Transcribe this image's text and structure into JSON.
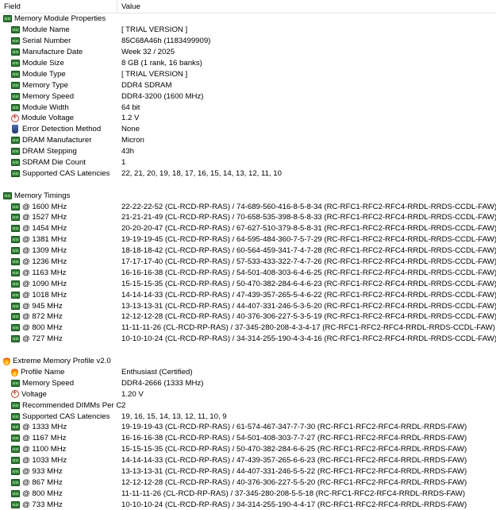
{
  "header": {
    "field": "Field",
    "value": "Value"
  },
  "rows": [
    {
      "type": "section",
      "icon": "ram",
      "field": "Memory Module Properties",
      "value": ""
    },
    {
      "type": "item",
      "icon": "ram",
      "field": "Module Name",
      "value": "[ TRIAL VERSION ]"
    },
    {
      "type": "item",
      "icon": "ram",
      "field": "Serial Number",
      "value": "85C68A46h (1183499909)"
    },
    {
      "type": "item",
      "icon": "ram",
      "field": "Manufacture Date",
      "value": "Week 32 / 2025"
    },
    {
      "type": "item",
      "icon": "ram",
      "field": "Module Size",
      "value": "8 GB (1 rank, 16 banks)"
    },
    {
      "type": "item",
      "icon": "ram",
      "field": "Module Type",
      "value": "[ TRIAL VERSION ]"
    },
    {
      "type": "item",
      "icon": "ram",
      "field": "Memory Type",
      "value": "DDR4 SDRAM"
    },
    {
      "type": "item",
      "icon": "ram",
      "field": "Memory Speed",
      "value": "DDR4-3200 (1600 MHz)"
    },
    {
      "type": "item",
      "icon": "ram",
      "field": "Module Width",
      "value": "64 bit"
    },
    {
      "type": "item",
      "icon": "volt",
      "field": "Module Voltage",
      "value": "1.2 V"
    },
    {
      "type": "item",
      "icon": "shield",
      "field": "Error Detection Method",
      "value": "None"
    },
    {
      "type": "item",
      "icon": "ram",
      "field": "DRAM Manufacturer",
      "value": "Micron"
    },
    {
      "type": "item",
      "icon": "ram",
      "field": "DRAM Stepping",
      "value": "43h"
    },
    {
      "type": "item",
      "icon": "ram",
      "field": "SDRAM Die Count",
      "value": "1"
    },
    {
      "type": "item",
      "icon": "ram",
      "field": "Supported CAS Latencies",
      "value": "22, 21, 20, 19, 18, 17, 16, 15, 14, 13, 12, 11, 10"
    },
    {
      "type": "blank"
    },
    {
      "type": "section",
      "icon": "ram",
      "field": "Memory Timings",
      "value": ""
    },
    {
      "type": "item",
      "icon": "ram",
      "field": "@ 1600 MHz",
      "value": "22-22-22-52  (CL-RCD-RP-RAS) / 74-689-560-416-8-5-8-34  (RC-RFC1-RFC2-RFC4-RRDL-RRDS-CCDL-FAW)"
    },
    {
      "type": "item",
      "icon": "ram",
      "field": "@ 1527 MHz",
      "value": "21-21-21-49  (CL-RCD-RP-RAS) / 70-658-535-398-8-5-8-33  (RC-RFC1-RFC2-RFC4-RRDL-RRDS-CCDL-FAW)"
    },
    {
      "type": "item",
      "icon": "ram",
      "field": "@ 1454 MHz",
      "value": "20-20-20-47  (CL-RCD-RP-RAS) / 67-627-510-379-8-5-8-31  (RC-RFC1-RFC2-RFC4-RRDL-RRDS-CCDL-FAW)"
    },
    {
      "type": "item",
      "icon": "ram",
      "field": "@ 1381 MHz",
      "value": "19-19-19-45  (CL-RCD-RP-RAS) / 64-595-484-360-7-5-7-29  (RC-RFC1-RFC2-RFC4-RRDL-RRDS-CCDL-FAW)"
    },
    {
      "type": "item",
      "icon": "ram",
      "field": "@ 1309 MHz",
      "value": "18-18-18-42  (CL-RCD-RP-RAS) / 60-564-459-341-7-4-7-28  (RC-RFC1-RFC2-RFC4-RRDL-RRDS-CCDL-FAW)"
    },
    {
      "type": "item",
      "icon": "ram",
      "field": "@ 1236 MHz",
      "value": "17-17-17-40  (CL-RCD-RP-RAS) / 57-533-433-322-7-4-7-26  (RC-RFC1-RFC2-RFC4-RRDL-RRDS-CCDL-FAW)"
    },
    {
      "type": "item",
      "icon": "ram",
      "field": "@ 1163 MHz",
      "value": "16-16-16-38  (CL-RCD-RP-RAS) / 54-501-408-303-6-4-6-25  (RC-RFC1-RFC2-RFC4-RRDL-RRDS-CCDL-FAW)"
    },
    {
      "type": "item",
      "icon": "ram",
      "field": "@ 1090 MHz",
      "value": "15-15-15-35  (CL-RCD-RP-RAS) / 50-470-382-284-6-4-6-23  (RC-RFC1-RFC2-RFC4-RRDL-RRDS-CCDL-FAW)"
    },
    {
      "type": "item",
      "icon": "ram",
      "field": "@ 1018 MHz",
      "value": "14-14-14-33  (CL-RCD-RP-RAS) / 47-439-357-265-5-4-6-22  (RC-RFC1-RFC2-RFC4-RRDL-RRDS-CCDL-FAW)"
    },
    {
      "type": "item",
      "icon": "ram",
      "field": "@ 945 MHz",
      "value": "13-13-13-31  (CL-RCD-RP-RAS) / 44-407-331-246-5-3-5-20  (RC-RFC1-RFC2-RFC4-RRDL-RRDS-CCDL-FAW)"
    },
    {
      "type": "item",
      "icon": "ram",
      "field": "@ 872 MHz",
      "value": "12-12-12-28  (CL-RCD-RP-RAS) / 40-376-306-227-5-3-5-19  (RC-RFC1-RFC2-RFC4-RRDL-RRDS-CCDL-FAW)"
    },
    {
      "type": "item",
      "icon": "ram",
      "field": "@ 800 MHz",
      "value": "11-11-11-26  (CL-RCD-RP-RAS) / 37-345-280-208-4-3-4-17  (RC-RFC1-RFC2-RFC4-RRDL-RRDS-CCDL-FAW)"
    },
    {
      "type": "item",
      "icon": "ram",
      "field": "@ 727 MHz",
      "value": "10-10-10-24  (CL-RCD-RP-RAS) / 34-314-255-190-4-3-4-16  (RC-RFC1-RFC2-RFC4-RRDL-RRDS-CCDL-FAW)"
    },
    {
      "type": "blank"
    },
    {
      "type": "section",
      "icon": "flame",
      "field": "Extreme Memory Profile v2.0",
      "value": ""
    },
    {
      "type": "item",
      "icon": "flame",
      "field": "Profile Name",
      "value": "Enthusiast (Certified)"
    },
    {
      "type": "item",
      "icon": "ram",
      "field": "Memory Speed",
      "value": "DDR4-2666 (1333 MHz)"
    },
    {
      "type": "item",
      "icon": "volt",
      "field": "Voltage",
      "value": "1.20 V"
    },
    {
      "type": "item",
      "icon": "ram",
      "field": "Recommended DIMMs Per C...",
      "value": "2"
    },
    {
      "type": "item",
      "icon": "ram",
      "field": "Supported CAS Latencies",
      "value": "19, 16, 15, 14, 13, 12, 11, 10, 9"
    },
    {
      "type": "item",
      "icon": "ram",
      "field": "@ 1333 MHz",
      "value": "19-19-19-43  (CL-RCD-RP-RAS) / 61-574-467-347-7-7-30  (RC-RFC1-RFC2-RFC4-RRDL-RRDS-FAW)"
    },
    {
      "type": "item",
      "icon": "ram",
      "field": "@ 1167 MHz",
      "value": "16-16-16-38  (CL-RCD-RP-RAS) / 54-501-408-303-7-7-27  (RC-RFC1-RFC2-RFC4-RRDL-RRDS-FAW)"
    },
    {
      "type": "item",
      "icon": "ram",
      "field": "@ 1100 MHz",
      "value": "15-15-15-35  (CL-RCD-RP-RAS) / 50-470-382-284-6-6-25  (RC-RFC1-RFC2-RFC4-RRDL-RRDS-FAW)"
    },
    {
      "type": "item",
      "icon": "ram",
      "field": "@ 1033 MHz",
      "value": "14-14-14-33  (CL-RCD-RP-RAS) / 47-439-357-265-6-6-23  (RC-RFC1-RFC2-RFC4-RRDL-RRDS-FAW)"
    },
    {
      "type": "item",
      "icon": "ram",
      "field": "@ 933 MHz",
      "value": "13-13-13-31  (CL-RCD-RP-RAS) / 44-407-331-246-5-5-22  (RC-RFC1-RFC2-RFC4-RRDL-RRDS-FAW)"
    },
    {
      "type": "item",
      "icon": "ram",
      "field": "@ 867 MHz",
      "value": "12-12-12-28  (CL-RCD-RP-RAS) / 40-376-306-227-5-5-20  (RC-RFC1-RFC2-RFC4-RRDL-RRDS-FAW)"
    },
    {
      "type": "item",
      "icon": "ram",
      "field": "@ 800 MHz",
      "value": "11-11-11-26  (CL-RCD-RP-RAS) / 37-345-280-208-5-5-18  (RC-RFC1-RFC2-RFC4-RRDL-RRDS-FAW)"
    },
    {
      "type": "item",
      "icon": "ram",
      "field": "@ 733 MHz",
      "value": "10-10-10-24  (CL-RCD-RP-RAS) / 34-314-255-190-4-4-17  (RC-RFC1-RFC2-RFC4-RRDL-RRDS-FAW)"
    }
  ]
}
